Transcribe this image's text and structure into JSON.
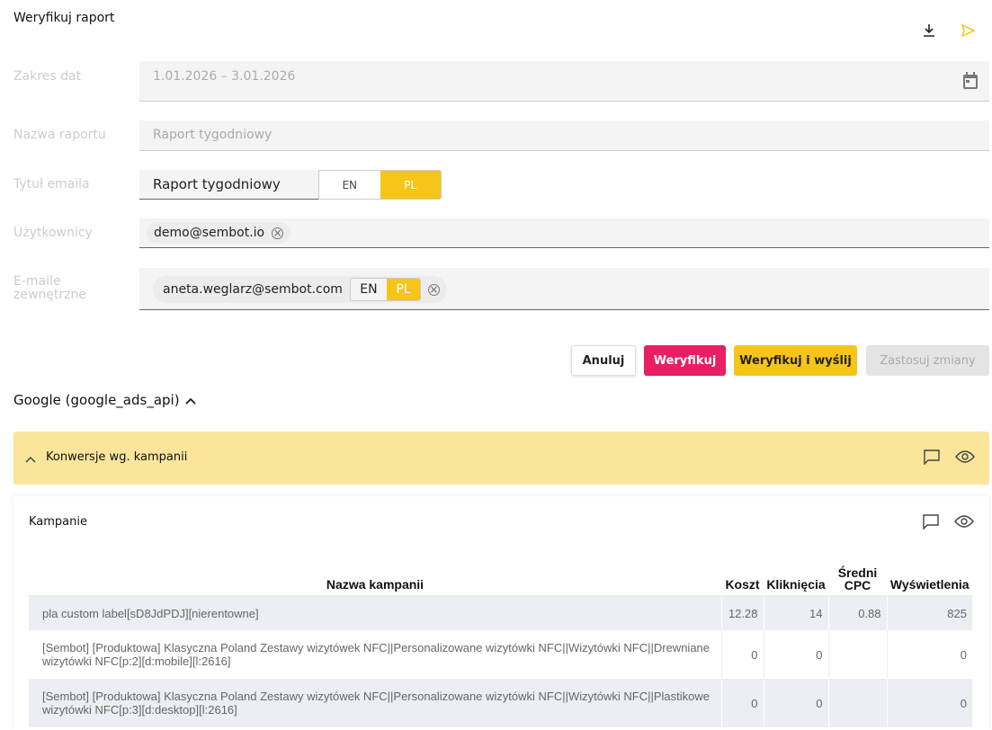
{
  "header": {
    "title": "Weryfikuj raport"
  },
  "form": {
    "date_range": {
      "label": "Zakres dat",
      "value": "1.01.2026  – 3.01.2026"
    },
    "report_name": {
      "label": "Nazwa raportu",
      "value": "Raport tygodniowy"
    },
    "email_title": {
      "label": "Tytuł emaila",
      "value": "Raport tygodniowy",
      "lang_en": "EN",
      "lang_pl": "PL"
    },
    "users": {
      "label": "Użytkownicy",
      "chips": [
        "demo@sembot.io"
      ]
    },
    "external_emails": {
      "label": "E-maile zewnętrzne",
      "chip": "aneta.weglarz@sembot.com",
      "lang_en": "EN",
      "lang_pl": "PL"
    }
  },
  "actions": {
    "cancel": "Anuluj",
    "verify": "Weryfikuj",
    "verify_send": "Weryfikuj i wyślij",
    "apply": "Zastosuj zmiany"
  },
  "section": {
    "title": "Google (google_ads_api)",
    "panel_title": "Konwersje wg. kampanii",
    "card_title": "Kampanie"
  },
  "table": {
    "headers": [
      "Nazwa kampanii",
      "Koszt",
      "Kliknięcia",
      "Średni CPC",
      "Wyświetlenia"
    ],
    "rows": [
      [
        "pla custom label[sD8JdPDJ][nierentowne]",
        "12.28",
        "14",
        "0.88",
        "825"
      ],
      [
        "[Sembot] [Produktowa] Klasyczna Poland Zestawy wizytówek NFC||Personalizowane wizytówki NFC||Wizytówki NFC||Drewniane wizytówki NFC[p:2][d:mobile][l:2616]",
        "0",
        "0",
        "",
        "0"
      ],
      [
        "[Sembot] [Produktowa] Klasyczna Poland Zestawy wizytówek NFC||Personalizowane wizytówki NFC||Wizytówki NFC||Plastikowe wizytówki NFC[p:3][d:desktop][l:2616]",
        "0",
        "0",
        "",
        "0"
      ]
    ]
  },
  "colors": {
    "accent": "#f5c518",
    "verify": "#e91e63",
    "panel": "#fae59b"
  }
}
